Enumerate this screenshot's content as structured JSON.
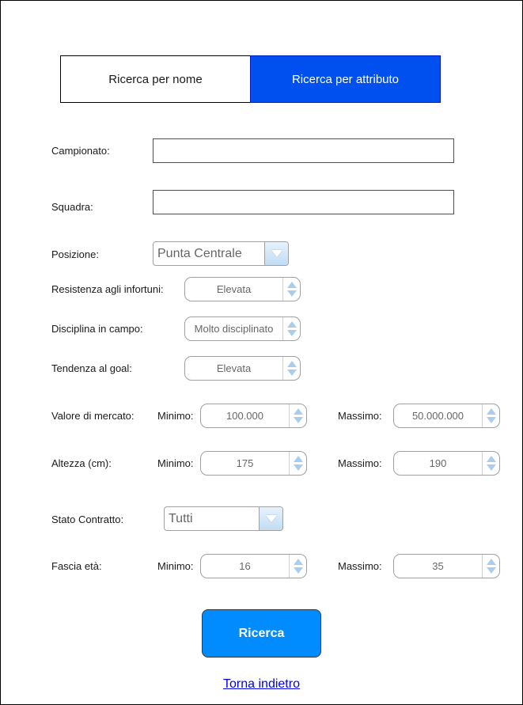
{
  "tabs": {
    "by_name": "Ricerca per nome",
    "by_attribute": "Ricerca per attributo",
    "active_color": "#0050ef"
  },
  "form": {
    "campionato": {
      "label": "Campionato:",
      "value": ""
    },
    "squadra": {
      "label": "Squadra:",
      "value": ""
    },
    "posizione": {
      "label": "Posizione:",
      "selected": "Punta Centrale"
    },
    "resistenza": {
      "label": "Resistenza agli infortuni:",
      "value": "Elevata"
    },
    "disciplina": {
      "label": "Disciplina in campo:",
      "value": "Molto disciplinato"
    },
    "tendenza": {
      "label": "Tendenza al goal:",
      "value": "Elevata"
    },
    "valore_mercato": {
      "label": "Valore di mercato:",
      "min_label": "Minimo:",
      "min": "100.000",
      "max_label": "Massimo:",
      "max": "50.000.000"
    },
    "altezza": {
      "label": "Altezza (cm):",
      "min_label": "Minimo:",
      "min": "175",
      "max_label": "Massimo:",
      "max": "190"
    },
    "stato_contratto": {
      "label": "Stato Contratto:",
      "selected": "Tutti"
    },
    "fascia_eta": {
      "label": "Fascia età:",
      "min_label": "Minimo:",
      "min": "16",
      "max_label": "Massimo:",
      "max": "35"
    }
  },
  "actions": {
    "search": "Ricerca",
    "back": "Torna indietro",
    "search_color": "#008cff"
  }
}
